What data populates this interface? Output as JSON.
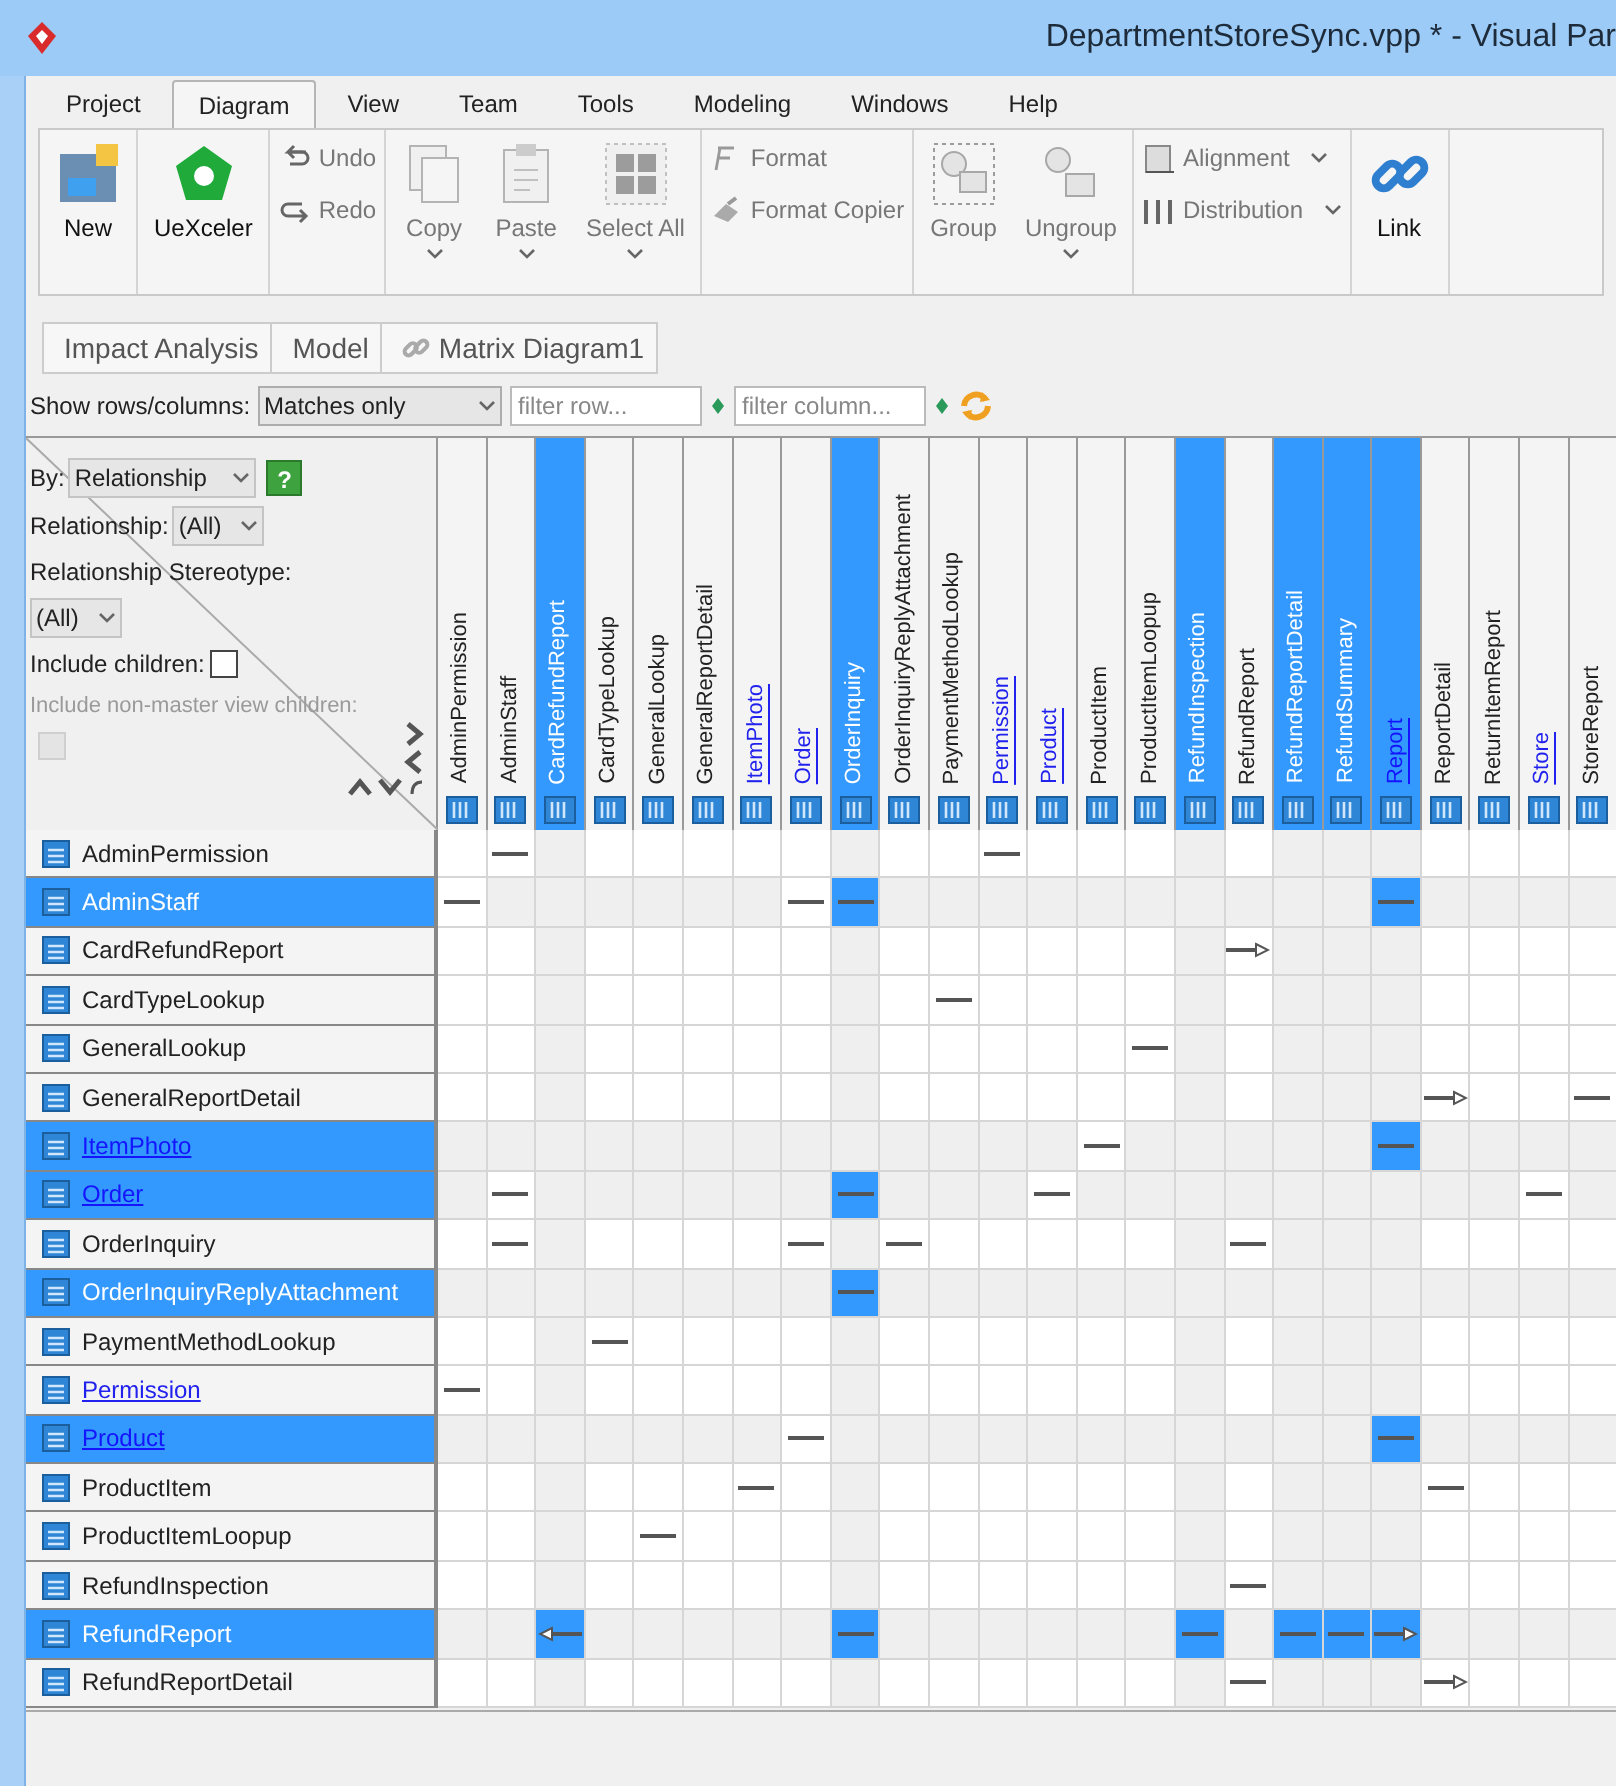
{
  "window": {
    "title": "DepartmentStoreSync.vpp * - Visual Par"
  },
  "menu_tabs": [
    {
      "label": "Project",
      "selected": false
    },
    {
      "label": "Diagram",
      "selected": true
    },
    {
      "label": "View",
      "selected": false
    },
    {
      "label": "Team",
      "selected": false
    },
    {
      "label": "Tools",
      "selected": false
    },
    {
      "label": "Modeling",
      "selected": false
    },
    {
      "label": "Windows",
      "selected": false
    },
    {
      "label": "Help",
      "selected": false
    }
  ],
  "ribbon": [
    [
      {
        "label": "New",
        "kind": "large",
        "disabled": false,
        "dropdown": false
      }
    ],
    [
      {
        "label": "UeXceler",
        "kind": "large",
        "disabled": false,
        "dropdown": false
      }
    ],
    [
      {
        "label": "Undo",
        "kind": "small",
        "disabled": true,
        "dropdown": false
      },
      {
        "label": "Redo",
        "kind": "small",
        "disabled": true,
        "dropdown": false
      }
    ],
    [
      {
        "label": "Copy",
        "kind": "large",
        "disabled": true,
        "dropdown": true
      },
      {
        "label": "Paste",
        "kind": "large",
        "disabled": true,
        "dropdown": true
      },
      {
        "label": "Select All",
        "kind": "large",
        "disabled": true,
        "dropdown": true
      }
    ],
    [
      {
        "label": "Format",
        "kind": "small",
        "disabled": true,
        "dropdown": false
      },
      {
        "label": "Format Copier",
        "kind": "small",
        "disabled": true,
        "dropdown": false
      }
    ],
    [
      {
        "label": "Group",
        "kind": "large",
        "disabled": true,
        "dropdown": false
      },
      {
        "label": "Ungroup",
        "kind": "large",
        "disabled": true,
        "dropdown": true
      }
    ],
    [
      {
        "label": "Alignment",
        "kind": "small",
        "disabled": true,
        "dropdown": true
      },
      {
        "label": "Distribution",
        "kind": "small",
        "disabled": true,
        "dropdown": true
      }
    ],
    [
      {
        "label": "Link",
        "kind": "large",
        "disabled": false,
        "dropdown": false
      }
    ]
  ],
  "breadcrumb": [
    "Impact Analysis",
    "Model",
    "Matrix Diagram1"
  ],
  "filter_bar": {
    "show_label": "Show rows/columns:",
    "show_value": "Matches only",
    "row_filter": {
      "placeholder": "filter row..."
    },
    "column_filter": {
      "placeholder": "filter column..."
    }
  },
  "options_panel": {
    "by_label": "By:",
    "by_value": "Relationship",
    "help": "?",
    "relationship_label": "Relationship:",
    "relationship_value": "(All)",
    "stereotype_label": "Relationship Stereotype:",
    "stereotype_value": "(All)",
    "include_children": {
      "label": "Include children:",
      "checked": false,
      "disabled": false
    },
    "include_non_master": {
      "label": "Include non-master view children:",
      "checked": false,
      "disabled": true
    }
  },
  "columns": [
    {
      "label": "AdminPermission",
      "selected": false,
      "link": false
    },
    {
      "label": "AdminStaff",
      "selected": false,
      "link": false
    },
    {
      "label": "CardRefundReport",
      "selected": true,
      "link": false
    },
    {
      "label": "CardTypeLookup",
      "selected": false,
      "link": false
    },
    {
      "label": "GeneralLookup",
      "selected": false,
      "link": false
    },
    {
      "label": "GeneralReportDetail",
      "selected": false,
      "link": false
    },
    {
      "label": "ItemPhoto",
      "selected": false,
      "link": true
    },
    {
      "label": "Order",
      "selected": false,
      "link": true
    },
    {
      "label": "OrderInquiry",
      "selected": true,
      "link": false
    },
    {
      "label": "OrderInquiryReplyAttachment",
      "selected": false,
      "link": false
    },
    {
      "label": "PaymentMethodLookup",
      "selected": false,
      "link": false
    },
    {
      "label": "Permission",
      "selected": false,
      "link": true
    },
    {
      "label": "Product",
      "selected": false,
      "link": true
    },
    {
      "label": "ProductItem",
      "selected": false,
      "link": false
    },
    {
      "label": "ProductItemLoopup",
      "selected": false,
      "link": false
    },
    {
      "label": "RefundInspection",
      "selected": true,
      "link": false
    },
    {
      "label": "RefundReport",
      "selected": false,
      "link": false
    },
    {
      "label": "RefundReportDetail",
      "selected": true,
      "link": false
    },
    {
      "label": "RefundSummary",
      "selected": true,
      "link": false
    },
    {
      "label": "Report",
      "selected": true,
      "link": true
    },
    {
      "label": "ReportDetail",
      "selected": false,
      "link": false
    },
    {
      "label": "ReturnItemReport",
      "selected": false,
      "link": false
    },
    {
      "label": "Store",
      "selected": false,
      "link": true
    },
    {
      "label": "StoreReport",
      "selected": false,
      "link": false
    }
  ],
  "rows": [
    {
      "label": "AdminPermission",
      "selected": false,
      "link": false,
      "cells": [
        {
          "kind": "empty"
        },
        {
          "kind": "line"
        },
        {
          "kind": "empty"
        },
        {
          "kind": "empty"
        },
        {
          "kind": "empty"
        },
        {
          "kind": "empty"
        },
        {
          "kind": "empty"
        },
        {
          "kind": "empty"
        },
        {
          "kind": "empty"
        },
        {
          "kind": "empty"
        },
        {
          "kind": "empty"
        },
        {
          "kind": "line"
        },
        {
          "kind": "empty"
        },
        {
          "kind": "empty"
        },
        {
          "kind": "empty"
        },
        {
          "kind": "empty"
        },
        {
          "kind": "empty"
        },
        {
          "kind": "empty"
        },
        {
          "kind": "empty"
        },
        {
          "kind": "empty"
        },
        {
          "kind": "empty"
        },
        {
          "kind": "empty"
        },
        {
          "kind": "empty"
        },
        {
          "kind": "empty"
        }
      ]
    },
    {
      "label": "AdminStaff",
      "selected": true,
      "link": false,
      "cells": [
        {
          "kind": "line"
        },
        {
          "kind": "empty"
        },
        {
          "kind": "empty"
        },
        {
          "kind": "empty"
        },
        {
          "kind": "empty"
        },
        {
          "kind": "empty"
        },
        {
          "kind": "empty"
        },
        {
          "kind": "line"
        },
        {
          "kind": "line"
        },
        {
          "kind": "empty"
        },
        {
          "kind": "empty"
        },
        {
          "kind": "empty"
        },
        {
          "kind": "empty"
        },
        {
          "kind": "empty"
        },
        {
          "kind": "empty"
        },
        {
          "kind": "empty"
        },
        {
          "kind": "empty"
        },
        {
          "kind": "empty"
        },
        {
          "kind": "empty"
        },
        {
          "kind": "line"
        },
        {
          "kind": "empty"
        },
        {
          "kind": "empty"
        },
        {
          "kind": "empty"
        },
        {
          "kind": "empty"
        }
      ]
    },
    {
      "label": "CardRefundReport",
      "selected": false,
      "link": false,
      "cells": [
        {
          "kind": "empty"
        },
        {
          "kind": "empty"
        },
        {
          "kind": "empty"
        },
        {
          "kind": "empty"
        },
        {
          "kind": "empty"
        },
        {
          "kind": "empty"
        },
        {
          "kind": "empty"
        },
        {
          "kind": "empty"
        },
        {
          "kind": "empty"
        },
        {
          "kind": "empty"
        },
        {
          "kind": "empty"
        },
        {
          "kind": "empty"
        },
        {
          "kind": "empty"
        },
        {
          "kind": "empty"
        },
        {
          "kind": "empty"
        },
        {
          "kind": "empty"
        },
        {
          "kind": "arrow_right"
        },
        {
          "kind": "empty"
        },
        {
          "kind": "empty"
        },
        {
          "kind": "empty"
        },
        {
          "kind": "empty"
        },
        {
          "kind": "empty"
        },
        {
          "kind": "empty"
        },
        {
          "kind": "empty"
        }
      ]
    },
    {
      "label": "CardTypeLookup",
      "selected": false,
      "link": false,
      "cells": [
        {
          "kind": "empty"
        },
        {
          "kind": "empty"
        },
        {
          "kind": "empty"
        },
        {
          "kind": "empty"
        },
        {
          "kind": "empty"
        },
        {
          "kind": "empty"
        },
        {
          "kind": "empty"
        },
        {
          "kind": "empty"
        },
        {
          "kind": "empty"
        },
        {
          "kind": "empty"
        },
        {
          "kind": "line"
        },
        {
          "kind": "empty"
        },
        {
          "kind": "empty"
        },
        {
          "kind": "empty"
        },
        {
          "kind": "empty"
        },
        {
          "kind": "empty"
        },
        {
          "kind": "empty"
        },
        {
          "kind": "empty"
        },
        {
          "kind": "empty"
        },
        {
          "kind": "empty"
        },
        {
          "kind": "empty"
        },
        {
          "kind": "empty"
        },
        {
          "kind": "empty"
        },
        {
          "kind": "empty"
        }
      ]
    },
    {
      "label": "GeneralLookup",
      "selected": false,
      "link": false,
      "cells": [
        {
          "kind": "empty"
        },
        {
          "kind": "empty"
        },
        {
          "kind": "empty"
        },
        {
          "kind": "empty"
        },
        {
          "kind": "empty"
        },
        {
          "kind": "empty"
        },
        {
          "kind": "empty"
        },
        {
          "kind": "empty"
        },
        {
          "kind": "empty"
        },
        {
          "kind": "empty"
        },
        {
          "kind": "empty"
        },
        {
          "kind": "empty"
        },
        {
          "kind": "empty"
        },
        {
          "kind": "empty"
        },
        {
          "kind": "line"
        },
        {
          "kind": "empty"
        },
        {
          "kind": "empty"
        },
        {
          "kind": "empty"
        },
        {
          "kind": "empty"
        },
        {
          "kind": "empty"
        },
        {
          "kind": "empty"
        },
        {
          "kind": "empty"
        },
        {
          "kind": "empty"
        },
        {
          "kind": "empty"
        }
      ]
    },
    {
      "label": "GeneralReportDetail",
      "selected": false,
      "link": false,
      "cells": [
        {
          "kind": "empty"
        },
        {
          "kind": "empty"
        },
        {
          "kind": "empty"
        },
        {
          "kind": "empty"
        },
        {
          "kind": "empty"
        },
        {
          "kind": "empty"
        },
        {
          "kind": "empty"
        },
        {
          "kind": "empty"
        },
        {
          "kind": "empty"
        },
        {
          "kind": "empty"
        },
        {
          "kind": "empty"
        },
        {
          "kind": "empty"
        },
        {
          "kind": "empty"
        },
        {
          "kind": "empty"
        },
        {
          "kind": "empty"
        },
        {
          "kind": "empty"
        },
        {
          "kind": "empty"
        },
        {
          "kind": "empty"
        },
        {
          "kind": "empty"
        },
        {
          "kind": "empty"
        },
        {
          "kind": "arrow_right"
        },
        {
          "kind": "empty"
        },
        {
          "kind": "empty"
        },
        {
          "kind": "line"
        }
      ]
    },
    {
      "label": "ItemPhoto",
      "selected": true,
      "link": true,
      "cells": [
        {
          "kind": "empty"
        },
        {
          "kind": "empty"
        },
        {
          "kind": "empty"
        },
        {
          "kind": "empty"
        },
        {
          "kind": "empty"
        },
        {
          "kind": "empty"
        },
        {
          "kind": "empty"
        },
        {
          "kind": "empty"
        },
        {
          "kind": "empty"
        },
        {
          "kind": "empty"
        },
        {
          "kind": "empty"
        },
        {
          "kind": "empty"
        },
        {
          "kind": "empty"
        },
        {
          "kind": "line"
        },
        {
          "kind": "empty"
        },
        {
          "kind": "empty"
        },
        {
          "kind": "empty"
        },
        {
          "kind": "empty"
        },
        {
          "kind": "empty"
        },
        {
          "kind": "line"
        },
        {
          "kind": "empty"
        },
        {
          "kind": "empty"
        },
        {
          "kind": "empty"
        },
        {
          "kind": "empty"
        }
      ]
    },
    {
      "label": "Order",
      "selected": true,
      "link": true,
      "cells": [
        {
          "kind": "empty"
        },
        {
          "kind": "line"
        },
        {
          "kind": "empty"
        },
        {
          "kind": "empty"
        },
        {
          "kind": "empty"
        },
        {
          "kind": "empty"
        },
        {
          "kind": "empty"
        },
        {
          "kind": "empty"
        },
        {
          "kind": "line"
        },
        {
          "kind": "empty"
        },
        {
          "kind": "empty"
        },
        {
          "kind": "empty"
        },
        {
          "kind": "line"
        },
        {
          "kind": "empty"
        },
        {
          "kind": "empty"
        },
        {
          "kind": "empty"
        },
        {
          "kind": "empty"
        },
        {
          "kind": "empty"
        },
        {
          "kind": "empty"
        },
        {
          "kind": "empty"
        },
        {
          "kind": "empty"
        },
        {
          "kind": "empty"
        },
        {
          "kind": "line"
        },
        {
          "kind": "empty"
        }
      ]
    },
    {
      "label": "OrderInquiry",
      "selected": false,
      "link": false,
      "cells": [
        {
          "kind": "empty"
        },
        {
          "kind": "line"
        },
        {
          "kind": "empty"
        },
        {
          "kind": "empty"
        },
        {
          "kind": "empty"
        },
        {
          "kind": "empty"
        },
        {
          "kind": "empty"
        },
        {
          "kind": "line"
        },
        {
          "kind": "empty"
        },
        {
          "kind": "line"
        },
        {
          "kind": "empty"
        },
        {
          "kind": "empty"
        },
        {
          "kind": "empty"
        },
        {
          "kind": "empty"
        },
        {
          "kind": "empty"
        },
        {
          "kind": "empty"
        },
        {
          "kind": "line"
        },
        {
          "kind": "empty"
        },
        {
          "kind": "empty"
        },
        {
          "kind": "empty"
        },
        {
          "kind": "empty"
        },
        {
          "kind": "empty"
        },
        {
          "kind": "empty"
        },
        {
          "kind": "empty"
        }
      ]
    },
    {
      "label": "OrderInquiryReplyAttachment",
      "selected": true,
      "link": false,
      "cells": [
        {
          "kind": "empty"
        },
        {
          "kind": "empty"
        },
        {
          "kind": "empty"
        },
        {
          "kind": "empty"
        },
        {
          "kind": "empty"
        },
        {
          "kind": "empty"
        },
        {
          "kind": "empty"
        },
        {
          "kind": "empty"
        },
        {
          "kind": "line"
        },
        {
          "kind": "empty"
        },
        {
          "kind": "empty"
        },
        {
          "kind": "empty"
        },
        {
          "kind": "empty"
        },
        {
          "kind": "empty"
        },
        {
          "kind": "empty"
        },
        {
          "kind": "empty"
        },
        {
          "kind": "empty"
        },
        {
          "kind": "empty"
        },
        {
          "kind": "empty"
        },
        {
          "kind": "empty"
        },
        {
          "kind": "empty"
        },
        {
          "kind": "empty"
        },
        {
          "kind": "empty"
        },
        {
          "kind": "empty"
        }
      ]
    },
    {
      "label": "PaymentMethodLookup",
      "selected": false,
      "link": false,
      "cells": [
        {
          "kind": "empty"
        },
        {
          "kind": "empty"
        },
        {
          "kind": "empty"
        },
        {
          "kind": "line"
        },
        {
          "kind": "empty"
        },
        {
          "kind": "empty"
        },
        {
          "kind": "empty"
        },
        {
          "kind": "empty"
        },
        {
          "kind": "empty"
        },
        {
          "kind": "empty"
        },
        {
          "kind": "empty"
        },
        {
          "kind": "empty"
        },
        {
          "kind": "empty"
        },
        {
          "kind": "empty"
        },
        {
          "kind": "empty"
        },
        {
          "kind": "empty"
        },
        {
          "kind": "empty"
        },
        {
          "kind": "empty"
        },
        {
          "kind": "empty"
        },
        {
          "kind": "empty"
        },
        {
          "kind": "empty"
        },
        {
          "kind": "empty"
        },
        {
          "kind": "empty"
        },
        {
          "kind": "empty"
        }
      ]
    },
    {
      "label": "Permission",
      "selected": false,
      "link": true,
      "cells": [
        {
          "kind": "line"
        },
        {
          "kind": "empty"
        },
        {
          "kind": "empty"
        },
        {
          "kind": "empty"
        },
        {
          "kind": "empty"
        },
        {
          "kind": "empty"
        },
        {
          "kind": "empty"
        },
        {
          "kind": "empty"
        },
        {
          "kind": "empty"
        },
        {
          "kind": "empty"
        },
        {
          "kind": "empty"
        },
        {
          "kind": "empty"
        },
        {
          "kind": "empty"
        },
        {
          "kind": "empty"
        },
        {
          "kind": "empty"
        },
        {
          "kind": "empty"
        },
        {
          "kind": "empty"
        },
        {
          "kind": "empty"
        },
        {
          "kind": "empty"
        },
        {
          "kind": "empty"
        },
        {
          "kind": "empty"
        },
        {
          "kind": "empty"
        },
        {
          "kind": "empty"
        },
        {
          "kind": "empty"
        }
      ]
    },
    {
      "label": "Product",
      "selected": true,
      "link": true,
      "cells": [
        {
          "kind": "empty"
        },
        {
          "kind": "empty"
        },
        {
          "kind": "empty"
        },
        {
          "kind": "empty"
        },
        {
          "kind": "empty"
        },
        {
          "kind": "empty"
        },
        {
          "kind": "empty"
        },
        {
          "kind": "line"
        },
        {
          "kind": "empty"
        },
        {
          "kind": "empty"
        },
        {
          "kind": "empty"
        },
        {
          "kind": "empty"
        },
        {
          "kind": "empty"
        },
        {
          "kind": "empty"
        },
        {
          "kind": "empty"
        },
        {
          "kind": "empty"
        },
        {
          "kind": "empty"
        },
        {
          "kind": "empty"
        },
        {
          "kind": "empty"
        },
        {
          "kind": "line"
        },
        {
          "kind": "empty"
        },
        {
          "kind": "empty"
        },
        {
          "kind": "empty"
        },
        {
          "kind": "empty"
        }
      ]
    },
    {
      "label": "ProductItem",
      "selected": false,
      "link": false,
      "cells": [
        {
          "kind": "empty"
        },
        {
          "kind": "empty"
        },
        {
          "kind": "empty"
        },
        {
          "kind": "empty"
        },
        {
          "kind": "empty"
        },
        {
          "kind": "empty"
        },
        {
          "kind": "line"
        },
        {
          "kind": "empty"
        },
        {
          "kind": "empty"
        },
        {
          "kind": "empty"
        },
        {
          "kind": "empty"
        },
        {
          "kind": "empty"
        },
        {
          "kind": "empty"
        },
        {
          "kind": "empty"
        },
        {
          "kind": "empty"
        },
        {
          "kind": "empty"
        },
        {
          "kind": "empty"
        },
        {
          "kind": "empty"
        },
        {
          "kind": "empty"
        },
        {
          "kind": "empty"
        },
        {
          "kind": "line"
        },
        {
          "kind": "empty"
        },
        {
          "kind": "empty"
        },
        {
          "kind": "empty"
        }
      ]
    },
    {
      "label": "ProductItemLoopup",
      "selected": false,
      "link": false,
      "cells": [
        {
          "kind": "empty"
        },
        {
          "kind": "empty"
        },
        {
          "kind": "empty"
        },
        {
          "kind": "empty"
        },
        {
          "kind": "line"
        },
        {
          "kind": "empty"
        },
        {
          "kind": "empty"
        },
        {
          "kind": "empty"
        },
        {
          "kind": "empty"
        },
        {
          "kind": "empty"
        },
        {
          "kind": "empty"
        },
        {
          "kind": "empty"
        },
        {
          "kind": "empty"
        },
        {
          "kind": "empty"
        },
        {
          "kind": "empty"
        },
        {
          "kind": "empty"
        },
        {
          "kind": "empty"
        },
        {
          "kind": "empty"
        },
        {
          "kind": "empty"
        },
        {
          "kind": "empty"
        },
        {
          "kind": "empty"
        },
        {
          "kind": "empty"
        },
        {
          "kind": "empty"
        },
        {
          "kind": "empty"
        }
      ]
    },
    {
      "label": "RefundInspection",
      "selected": false,
      "link": false,
      "cells": [
        {
          "kind": "empty"
        },
        {
          "kind": "empty"
        },
        {
          "kind": "empty"
        },
        {
          "kind": "empty"
        },
        {
          "kind": "empty"
        },
        {
          "kind": "empty"
        },
        {
          "kind": "empty"
        },
        {
          "kind": "empty"
        },
        {
          "kind": "empty"
        },
        {
          "kind": "empty"
        },
        {
          "kind": "empty"
        },
        {
          "kind": "empty"
        },
        {
          "kind": "empty"
        },
        {
          "kind": "empty"
        },
        {
          "kind": "empty"
        },
        {
          "kind": "empty"
        },
        {
          "kind": "line"
        },
        {
          "kind": "empty"
        },
        {
          "kind": "empty"
        },
        {
          "kind": "empty"
        },
        {
          "kind": "empty"
        },
        {
          "kind": "empty"
        },
        {
          "kind": "empty"
        },
        {
          "kind": "empty"
        }
      ]
    },
    {
      "label": "RefundReport",
      "selected": true,
      "link": false,
      "cells": [
        {
          "kind": "empty"
        },
        {
          "kind": "empty"
        },
        {
          "kind": "arrow_left"
        },
        {
          "kind": "empty"
        },
        {
          "kind": "empty"
        },
        {
          "kind": "empty"
        },
        {
          "kind": "empty"
        },
        {
          "kind": "empty"
        },
        {
          "kind": "line"
        },
        {
          "kind": "empty"
        },
        {
          "kind": "empty"
        },
        {
          "kind": "empty"
        },
        {
          "kind": "empty"
        },
        {
          "kind": "empty"
        },
        {
          "kind": "empty"
        },
        {
          "kind": "line"
        },
        {
          "kind": "empty"
        },
        {
          "kind": "line"
        },
        {
          "kind": "line"
        },
        {
          "kind": "arrow_right"
        },
        {
          "kind": "empty"
        },
        {
          "kind": "empty"
        },
        {
          "kind": "empty"
        },
        {
          "kind": "empty"
        }
      ]
    },
    {
      "label": "RefundReportDetail",
      "selected": false,
      "link": false,
      "cells": [
        {
          "kind": "empty"
        },
        {
          "kind": "empty"
        },
        {
          "kind": "empty"
        },
        {
          "kind": "empty"
        },
        {
          "kind": "empty"
        },
        {
          "kind": "empty"
        },
        {
          "kind": "empty"
        },
        {
          "kind": "empty"
        },
        {
          "kind": "empty"
        },
        {
          "kind": "empty"
        },
        {
          "kind": "empty"
        },
        {
          "kind": "empty"
        },
        {
          "kind": "empty"
        },
        {
          "kind": "empty"
        },
        {
          "kind": "empty"
        },
        {
          "kind": "empty"
        },
        {
          "kind": "line"
        },
        {
          "kind": "empty"
        },
        {
          "kind": "empty"
        },
        {
          "kind": "empty"
        },
        {
          "kind": "arrow_right"
        },
        {
          "kind": "empty"
        },
        {
          "kind": "empty"
        },
        {
          "kind": "empty"
        }
      ]
    }
  ]
}
